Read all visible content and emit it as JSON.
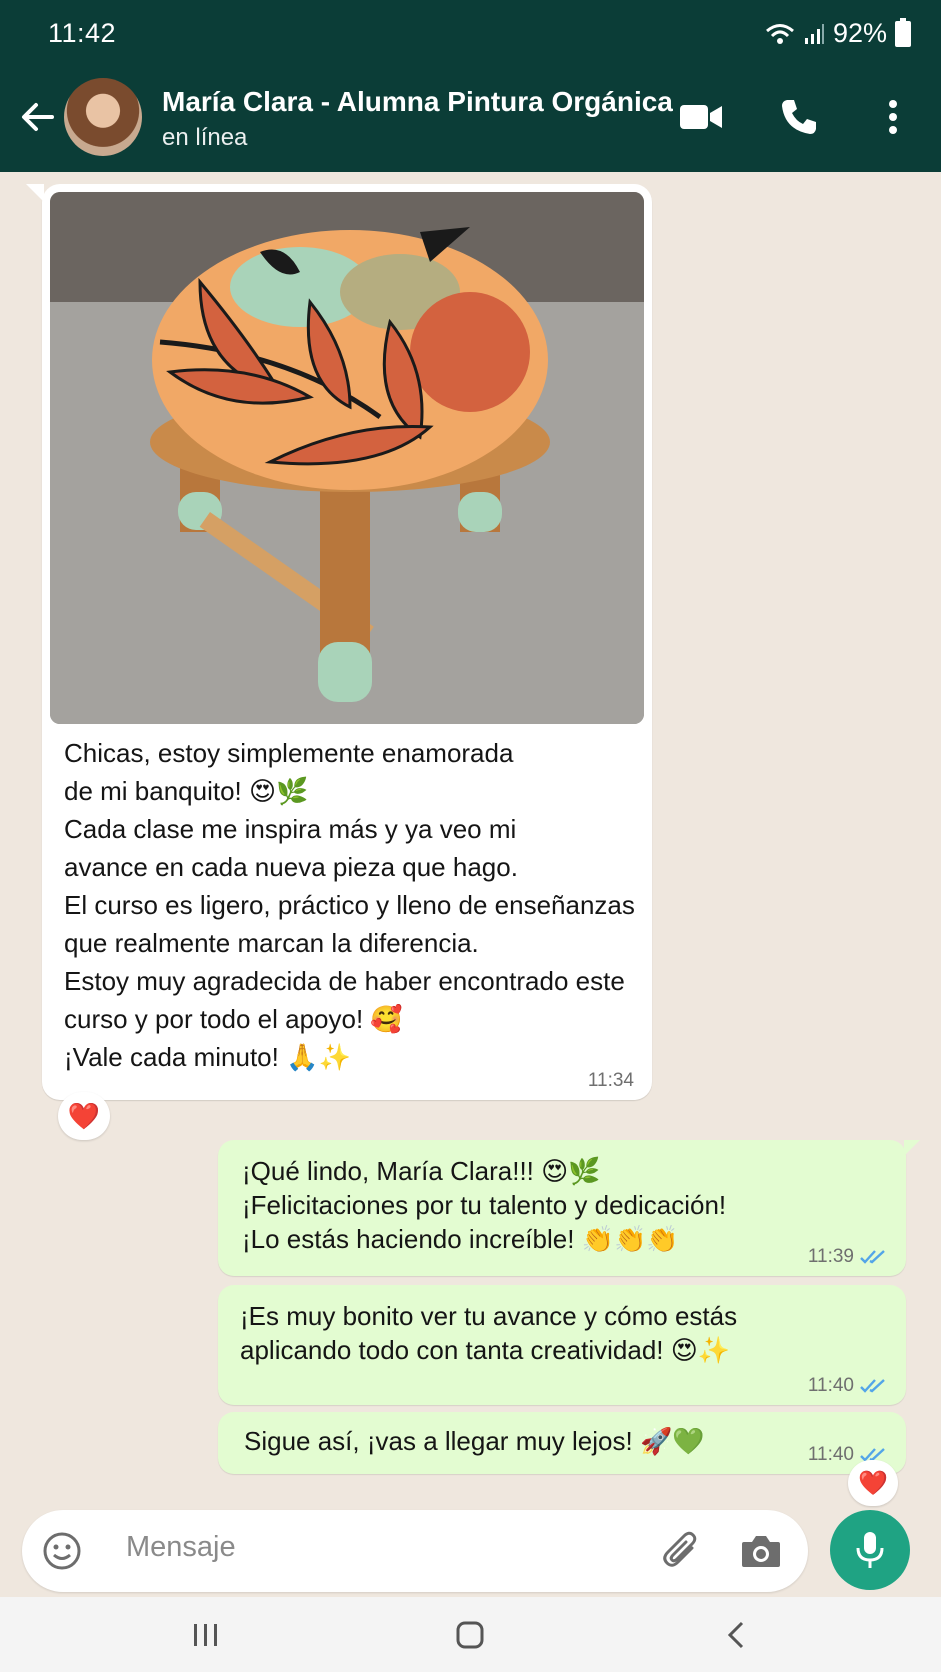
{
  "status_bar": {
    "time": "11:42",
    "battery": "92%"
  },
  "header": {
    "contact_name": "María Clara - Alumna Pintura Orgánica",
    "presence": "en línea"
  },
  "messages": {
    "incoming": {
      "lines": [
        "Chicas, estoy simplemente enamorada",
        "de mi banquito! 😍🌿",
        "Cada clase me inspira más y ya veo mi",
        "avance en cada nueva pieza que hago.",
        "El curso es ligero, práctico y lleno de enseñanzas",
        "que realmente marcan la diferencia.",
        "Estoy muy agradecida de haber encontrado este",
        "curso y por todo el apoyo! 🥰",
        "¡Vale cada minuto! 🙏✨"
      ],
      "time": "11:34",
      "reaction": "❤️"
    },
    "outgoing": [
      {
        "lines": [
          "¡Qué lindo, María Clara!!! 😍🌿",
          "¡Felicitaciones por tu talento y dedicación!",
          "¡Lo estás haciendo increíble! 👏👏👏"
        ],
        "time": "11:39"
      },
      {
        "lines": [
          "¡Es muy bonito ver tu avance y cómo estás",
          "aplicando todo con tanta creatividad! 😍✨"
        ],
        "time": "11:40"
      },
      {
        "lines": [
          "Sigue así, ¡vas a llegar muy lejos! 🚀💚"
        ],
        "time": "11:40",
        "reaction": "❤️"
      }
    ]
  },
  "composer": {
    "placeholder": "Mensaje"
  },
  "colors": {
    "header_bg": "#0b3d37",
    "outgoing_bubble": "#e3fcd1",
    "mic_button": "#1fa383",
    "read_ticks": "#53a5e8"
  },
  "icons": [
    "back-arrow-icon",
    "video-call-icon",
    "phone-icon",
    "more-vert-icon",
    "emoji-icon",
    "attach-icon",
    "camera-icon",
    "mic-icon",
    "wifi-icon",
    "signal-icon",
    "battery-icon",
    "recents-nav-icon",
    "home-nav-icon",
    "back-nav-icon",
    "double-check-icon"
  ]
}
